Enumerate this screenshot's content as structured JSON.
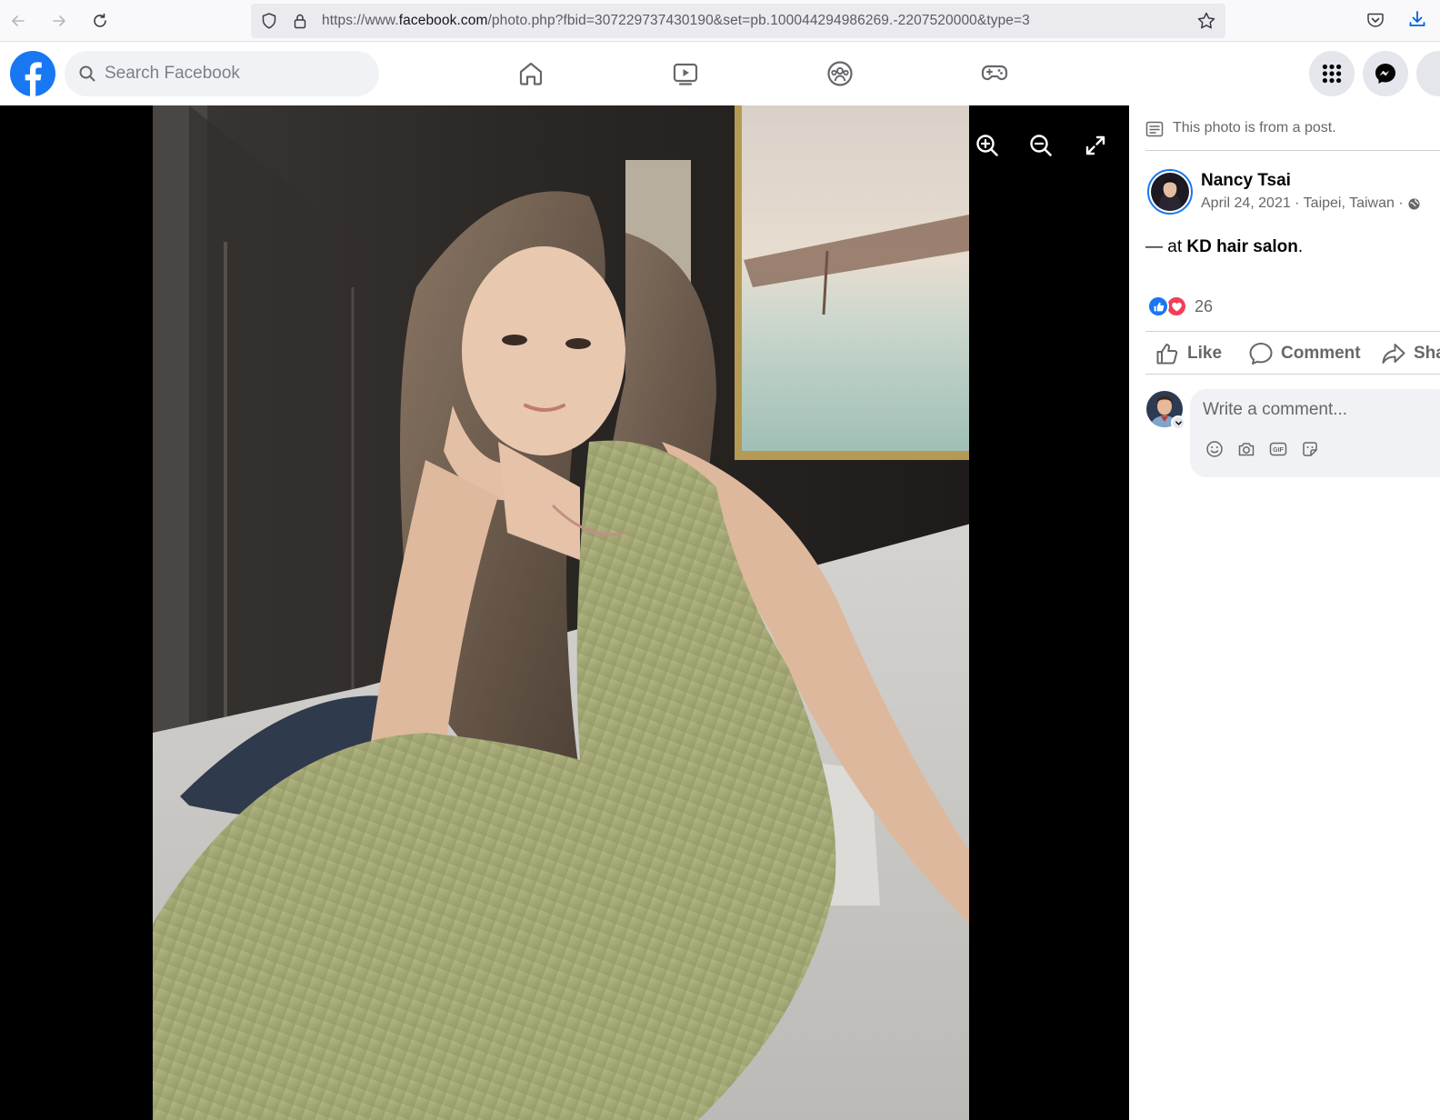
{
  "browser": {
    "url_prefix": "https://www.",
    "url_domain": "facebook.com",
    "url_rest": "/photo.php?fbid=307229737430190&set=pb.100044294986269.-2207520000&type=3"
  },
  "header": {
    "search_placeholder": "Search Facebook"
  },
  "panel": {
    "post_note": "This photo is from a post.",
    "author_name": "Nancy Tsai",
    "post_meta": "April 24, 2021 · Taipei, Taiwan ·",
    "post_text_prefix": "— at ",
    "post_text_place": "KD hair salon",
    "post_text_suffix": ".",
    "reaction_count": "26",
    "actions": {
      "like": "Like",
      "comment": "Comment",
      "share": "Share"
    },
    "comment_placeholder": "Write a comment..."
  },
  "colors": {
    "brand": "#1877f2",
    "love": "#f33e58",
    "secondary_text": "#65676b"
  }
}
